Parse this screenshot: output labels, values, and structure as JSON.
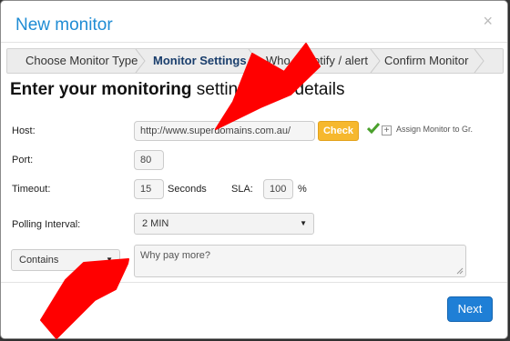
{
  "modal": {
    "title": "New monitor",
    "close_glyph": "×"
  },
  "wizard": {
    "steps": [
      {
        "label": "Choose Monitor Type"
      },
      {
        "label": "Monitor Settings"
      },
      {
        "label": "Who to notify / alert"
      },
      {
        "label": "Confirm Monitor"
      }
    ]
  },
  "heading": {
    "bold": "Enter your monitoring",
    "rest": " settings and details"
  },
  "form": {
    "host_label": "Host:",
    "host_value": "http://www.superdomains.com.au/",
    "check_label": "Check",
    "assign_label": "Assign Monitor to Gr.",
    "port_label": "Port:",
    "port_value": "80",
    "timeout_label": "Timeout:",
    "timeout_value": "15",
    "seconds_label": "Seconds",
    "sla_label": "SLA:",
    "sla_value": "100",
    "percent_label": "%",
    "polling_label": "Polling Interval:",
    "polling_value": "2 MIN",
    "match_select": "Contains",
    "match_text": "Why pay more?"
  },
  "footer": {
    "next_label": "Next"
  },
  "colors": {
    "title": "#1f8cd4",
    "check_button": "#f6b82e",
    "next_button": "#1f7fd6",
    "annotation_arrow": "#ff0000"
  }
}
